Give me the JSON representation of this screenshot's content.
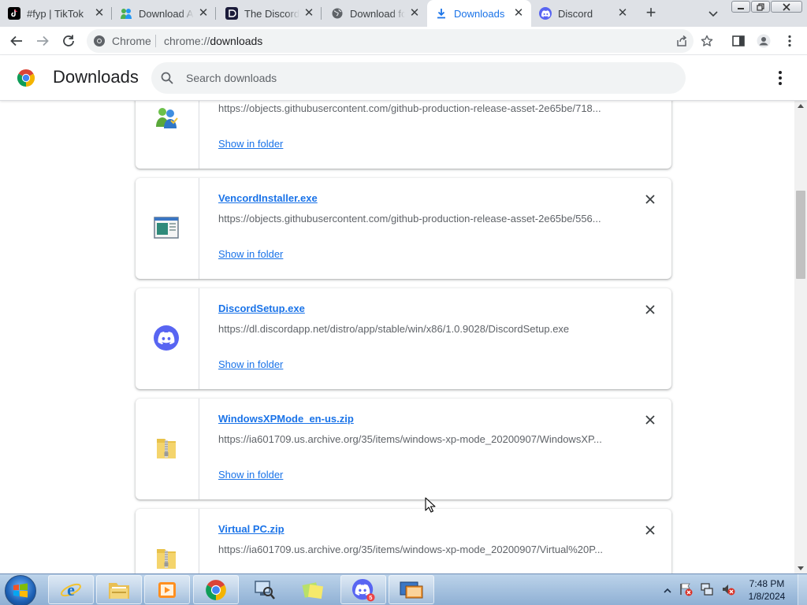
{
  "tabs": [
    {
      "title": "#fyp | TikTok",
      "icon": "tiktok-icon"
    },
    {
      "title": "Download Aero",
      "icon": "msn-icon"
    },
    {
      "title": "The Discord",
      "icon": "discord-badge-icon"
    },
    {
      "title": "Download for",
      "icon": "globe-icon"
    },
    {
      "title": "Downloads",
      "icon": "download-icon",
      "active": true
    },
    {
      "title": "Discord",
      "icon": "discord-icon"
    }
  ],
  "omnibox": {
    "chip": "Chrome",
    "url_scheme": "chrome://",
    "url_host": "downloads"
  },
  "header": {
    "title": "Downloads",
    "search_placeholder": "Search downloads"
  },
  "downloads": [
    {
      "name": "",
      "url": "https://objects.githubusercontent.com/github-production-release-asset-2e65be/718...",
      "action": "Show in folder",
      "icon": "msn-messenger-icon"
    },
    {
      "name": "VencordInstaller.exe",
      "url": "https://objects.githubusercontent.com/github-production-release-asset-2e65be/556...",
      "action": "Show in folder",
      "icon": "exe-window-icon"
    },
    {
      "name": "DiscordSetup.exe",
      "url": "https://dl.discordapp.net/distro/app/stable/win/x86/1.0.9028/DiscordSetup.exe",
      "action": "Show in folder",
      "icon": "discord-icon"
    },
    {
      "name": "WindowsXPMode_en-us.zip",
      "url": "https://ia601709.us.archive.org/35/items/windows-xp-mode_20200907/WindowsXP...",
      "action": "Show in folder",
      "icon": "zip-folder-icon"
    },
    {
      "name": "Virtual PC.zip",
      "url": "https://ia601709.us.archive.org/35/items/windows-xp-mode_20200907/Virtual%20P...",
      "action": "",
      "icon": "zip-folder-icon"
    }
  ],
  "taskbar": {
    "apps": [
      "internet-explorer-icon",
      "file-explorer-icon",
      "media-player-icon",
      "chrome-icon",
      "network-scanner-icon",
      "sticky-notes-icon",
      "discord-icon",
      "remote-desktop-icon"
    ],
    "discord_badge": "5",
    "clock_time": "7:48 PM",
    "clock_date": "1/8/2024"
  },
  "colors": {
    "accent": "#1a73e8",
    "discord": "#5865f2",
    "tab_strip": "#dee1e6"
  }
}
